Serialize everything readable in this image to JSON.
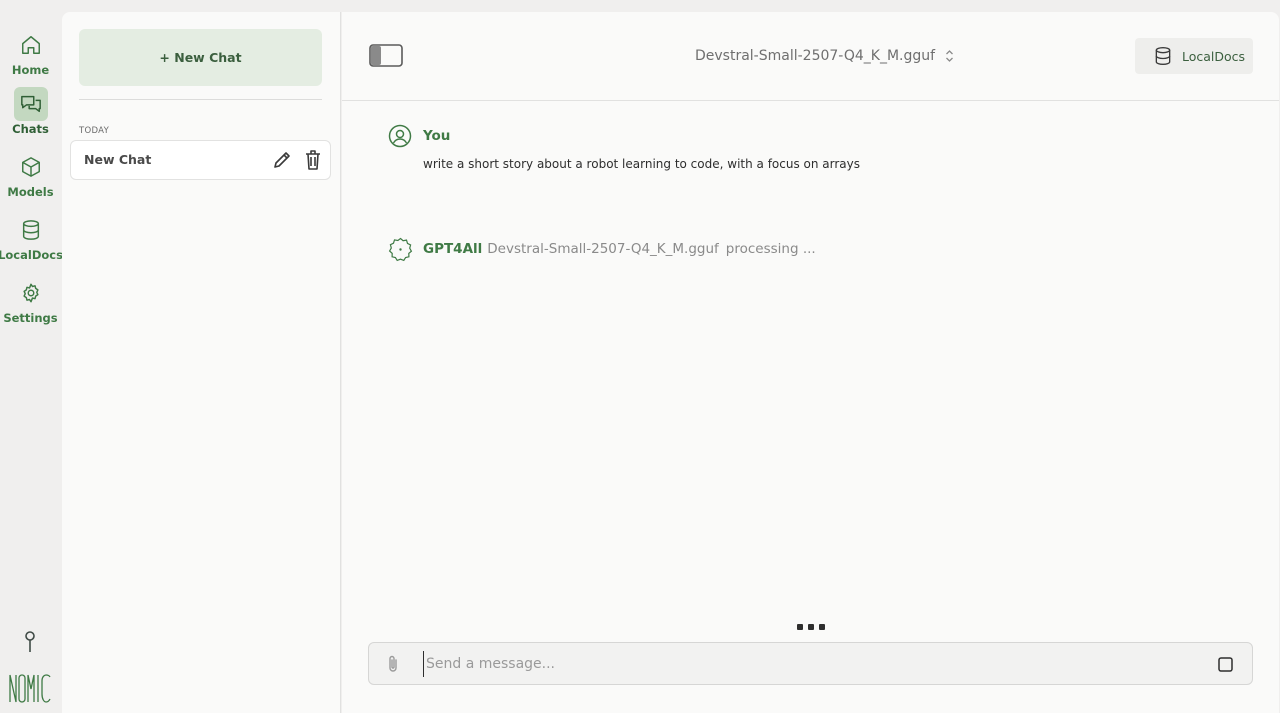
{
  "rail": {
    "items": [
      {
        "label": "Home",
        "icon": "home-icon"
      },
      {
        "label": "Chats",
        "icon": "chat-bubbles-icon",
        "active": true
      },
      {
        "label": "Models",
        "icon": "cube-icon"
      },
      {
        "label": "LocalDocs",
        "icon": "database-icon"
      },
      {
        "label": "Settings",
        "icon": "gear-icon"
      }
    ],
    "logo_text": "NOMIC"
  },
  "sidebar": {
    "new_chat_label": "+ New Chat",
    "section_label": "TODAY",
    "chats": [
      {
        "title": "New Chat"
      }
    ]
  },
  "header": {
    "model_name": "Devstral-Small-2507-Q4_K_M.gguf",
    "localdocs_label": "LocalDocs"
  },
  "conversation": {
    "user": {
      "name": "You",
      "text": "write a short story about a robot learning to code, with a focus on arrays"
    },
    "assistant": {
      "name": "GPT4All",
      "model": "Devstral-Small-2507-Q4_K_M.gguf",
      "status": "processing ..."
    }
  },
  "composer": {
    "placeholder": "Send a message..."
  },
  "colors": {
    "accent": "#3f7a45",
    "accent_light": "#e4ede2",
    "active_rail": "#c3d8c0",
    "background": "#f0efee",
    "surface": "#fafaf9"
  }
}
